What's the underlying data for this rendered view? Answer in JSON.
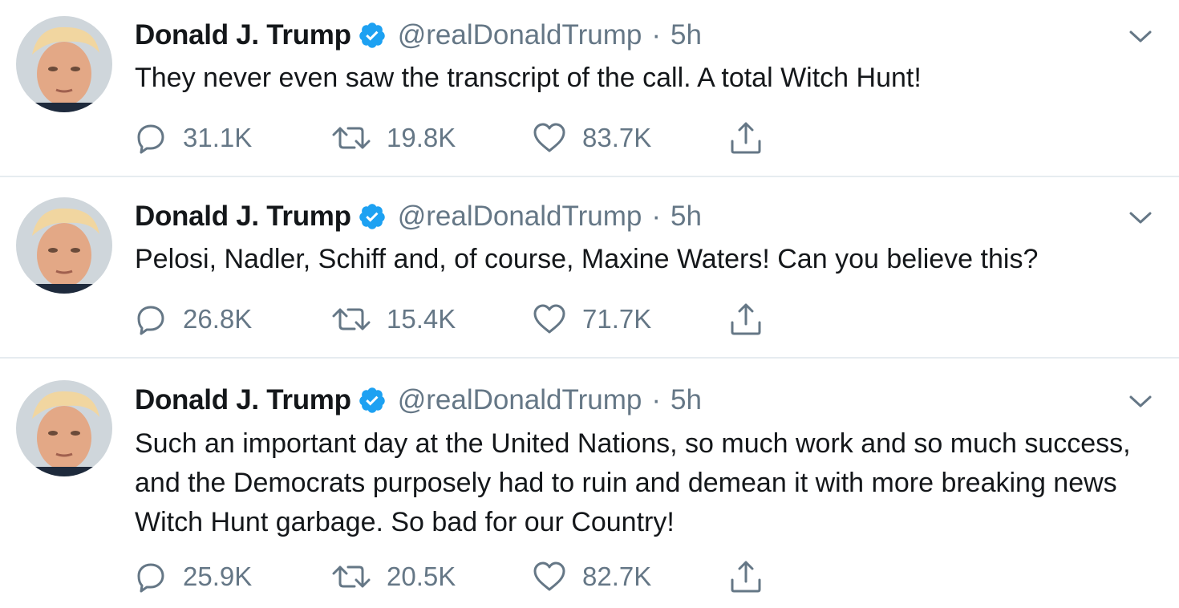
{
  "colors": {
    "text_primary": "#14171a",
    "text_secondary": "#657786",
    "verified_blue": "#1da1f2",
    "divider": "#e6ecf0"
  },
  "icons": {
    "verified": "verified-badge-icon",
    "caret": "chevron-down-icon",
    "reply": "reply-icon",
    "retweet": "retweet-icon",
    "like": "heart-icon",
    "share": "share-icon"
  },
  "tweets": [
    {
      "name": "Donald J. Trump",
      "handle": "@realDonaldTrump",
      "separator": "·",
      "time": "5h",
      "text": "They never even saw the transcript of the call. A total Witch Hunt!",
      "replies": "31.1K",
      "retweets": "19.8K",
      "likes": "83.7K"
    },
    {
      "name": "Donald J. Trump",
      "handle": "@realDonaldTrump",
      "separator": "·",
      "time": "5h",
      "text": "Pelosi, Nadler, Schiff and, of course, Maxine Waters! Can you believe this?",
      "replies": "26.8K",
      "retweets": "15.4K",
      "likes": "71.7K"
    },
    {
      "name": "Donald J. Trump",
      "handle": "@realDonaldTrump",
      "separator": "·",
      "time": "5h",
      "text": "Such an important day at the United Nations, so much work and so much success, and the Democrats purposely had to ruin and demean it with more breaking news Witch Hunt garbage. So bad for our Country!",
      "replies": "25.9K",
      "retweets": "20.5K",
      "likes": "82.7K"
    }
  ]
}
